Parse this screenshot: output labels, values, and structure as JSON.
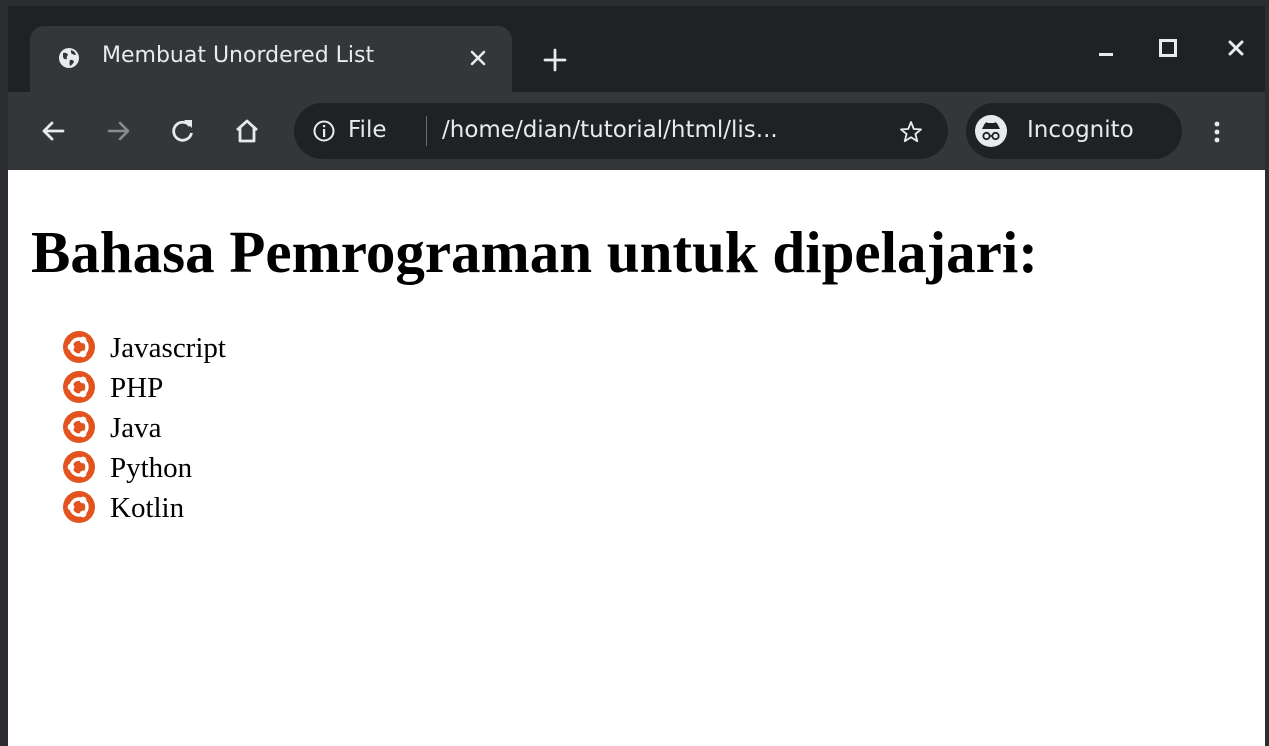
{
  "tab": {
    "title": "Membuat Unordered List",
    "favicon": "globe-icon"
  },
  "toolbar": {
    "scheme": "File",
    "url": "/home/dian/tutorial/html/lis...",
    "profile_label": "Incognito"
  },
  "colors": {
    "tab_strip": "#202124",
    "toolbar": "#35363a",
    "omnibox": "#202124",
    "bullet": "#e2531d"
  },
  "page": {
    "heading": "Bahasa Pemrograman untuk dipelajari:",
    "list_items": [
      "Javascript",
      "PHP",
      "Java",
      "Python",
      "Kotlin"
    ]
  }
}
